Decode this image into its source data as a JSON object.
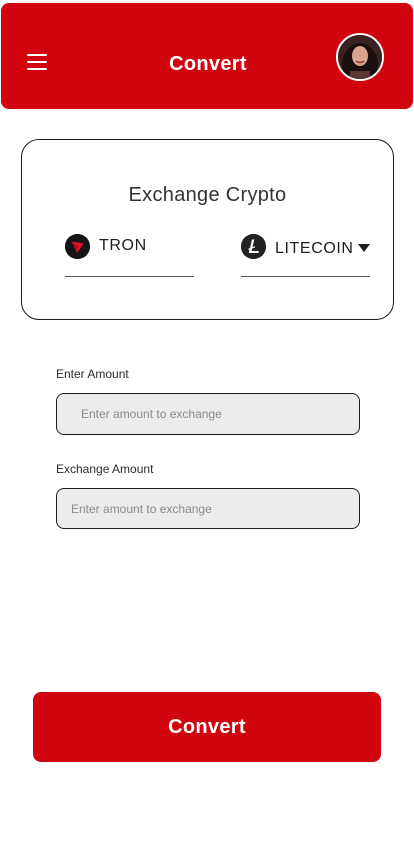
{
  "header": {
    "title": "Convert",
    "menu_icon": "hamburger-menu-icon",
    "avatar_alt": "user avatar"
  },
  "exchange": {
    "title": "Exchange Crypto",
    "from_coin": {
      "label": "TRON",
      "icon": "tron-icon"
    },
    "to_coin": {
      "label": "LITECOIN",
      "icon": "litecoin-icon"
    }
  },
  "form": {
    "amount_label": "Enter Amount",
    "amount_placeholder": "Enter amount to exchange",
    "amount_value": "",
    "exchange_label": "Exchange Amount",
    "exchange_placeholder": "Enter amount to exchange",
    "exchange_value": ""
  },
  "action": {
    "convert_label": "Convert"
  },
  "colors": {
    "brand": "#d0050f",
    "field_bg": "#ececec",
    "text": "#2e2e2e"
  }
}
